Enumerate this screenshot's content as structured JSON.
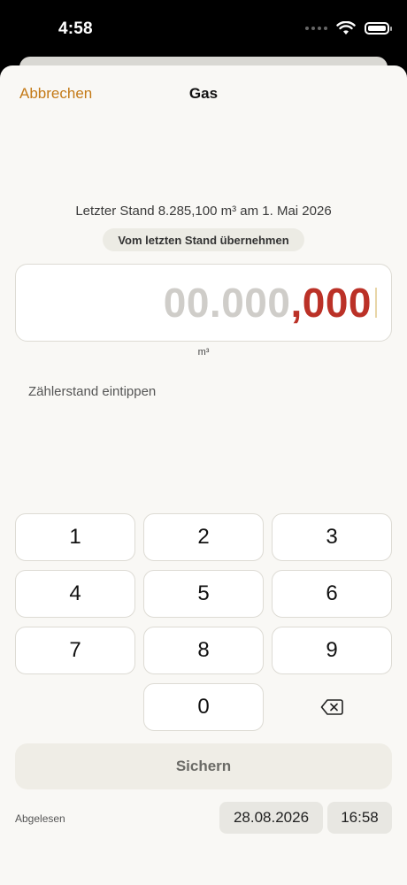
{
  "status": {
    "time": "4:58"
  },
  "nav": {
    "cancel_label": "Abbrechen",
    "title": "Gas"
  },
  "last_reading": {
    "text": "Letzter Stand 8.285,100 m³ am 1. Mai 2026",
    "adopt_label": "Vom letzten Stand übernehmen"
  },
  "reading": {
    "integer": "00.000",
    "separator": ",",
    "decimals": "000",
    "unit": "m³"
  },
  "hint": "Zählerstand eintippen",
  "keypad": {
    "k1": "1",
    "k2": "2",
    "k3": "3",
    "k4": "4",
    "k5": "5",
    "k6": "6",
    "k7": "7",
    "k8": "8",
    "k9": "9",
    "k0": "0",
    "delete_icon": "backspace-icon"
  },
  "footer": {
    "save_label": "Sichern",
    "read_label": "Abgelesen",
    "date": "28.08.2026",
    "time": "16:58"
  },
  "colors": {
    "accent": "#c47a17",
    "decimal": "#bb3127",
    "background": "#f9f8f5"
  }
}
